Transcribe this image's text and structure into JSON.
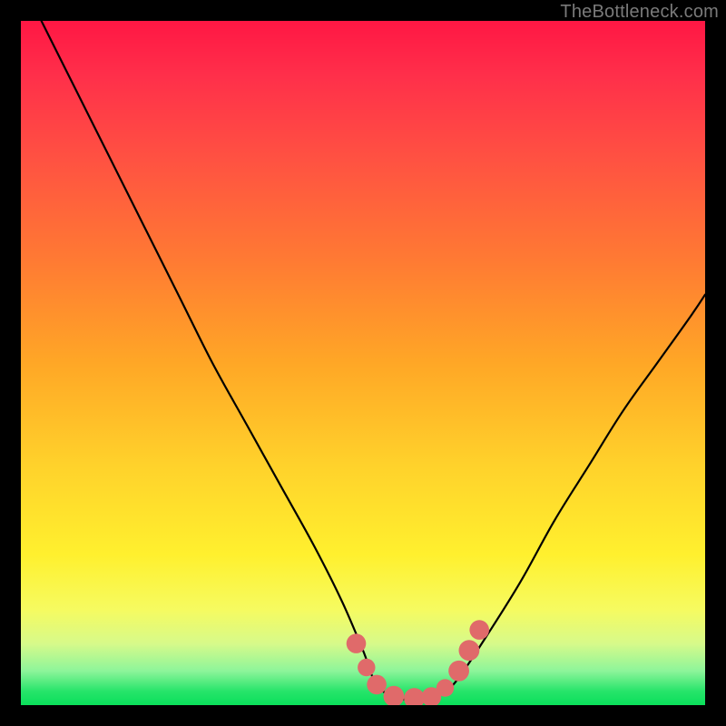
{
  "watermark": {
    "text": "TheBottleneck.com"
  },
  "colors": {
    "page_bg": "#000000",
    "gradient_top": "#ff1744",
    "gradient_mid": "#ffd22b",
    "gradient_bottom": "#0adf5a",
    "curve_stroke": "#000000",
    "marker_fill": "#e06a6a",
    "marker_stroke": "#b94f4f"
  },
  "chart_data": {
    "type": "line",
    "title": "",
    "xlabel": "",
    "ylabel": "",
    "xlim": [
      0,
      100
    ],
    "ylim": [
      0,
      100
    ],
    "grid": false,
    "legend": false,
    "note": "V-shaped bottleneck curve. X is component ratio (0–100). Y is bottleneck percentage (0–100). Valley floor (~0%) spans roughly x=52–62; right arm exits near y≈60 at x=100.",
    "series": [
      {
        "name": "bottleneck_curve",
        "x": [
          3,
          8,
          13,
          18,
          23,
          28,
          33,
          38,
          43,
          47,
          50,
          52,
          55,
          58,
          60,
          62,
          64,
          68,
          73,
          78,
          83,
          88,
          93,
          98,
          100
        ],
        "values": [
          100,
          90,
          80,
          70,
          60,
          50,
          41,
          32,
          23,
          15,
          8,
          3,
          1,
          1,
          1,
          2,
          4,
          10,
          18,
          27,
          35,
          43,
          50,
          57,
          60
        ]
      }
    ],
    "markers": [
      {
        "x": 49.0,
        "y": 9.0,
        "r": 1.2
      },
      {
        "x": 50.5,
        "y": 5.5,
        "r": 1.0
      },
      {
        "x": 52.0,
        "y": 3.0,
        "r": 1.2
      },
      {
        "x": 54.5,
        "y": 1.3,
        "r": 1.3
      },
      {
        "x": 57.5,
        "y": 1.0,
        "r": 1.3
      },
      {
        "x": 60.0,
        "y": 1.2,
        "r": 1.2
      },
      {
        "x": 62.0,
        "y": 2.5,
        "r": 1.0
      },
      {
        "x": 64.0,
        "y": 5.0,
        "r": 1.3
      },
      {
        "x": 65.5,
        "y": 8.0,
        "r": 1.3
      },
      {
        "x": 67.0,
        "y": 11.0,
        "r": 1.2
      }
    ]
  }
}
